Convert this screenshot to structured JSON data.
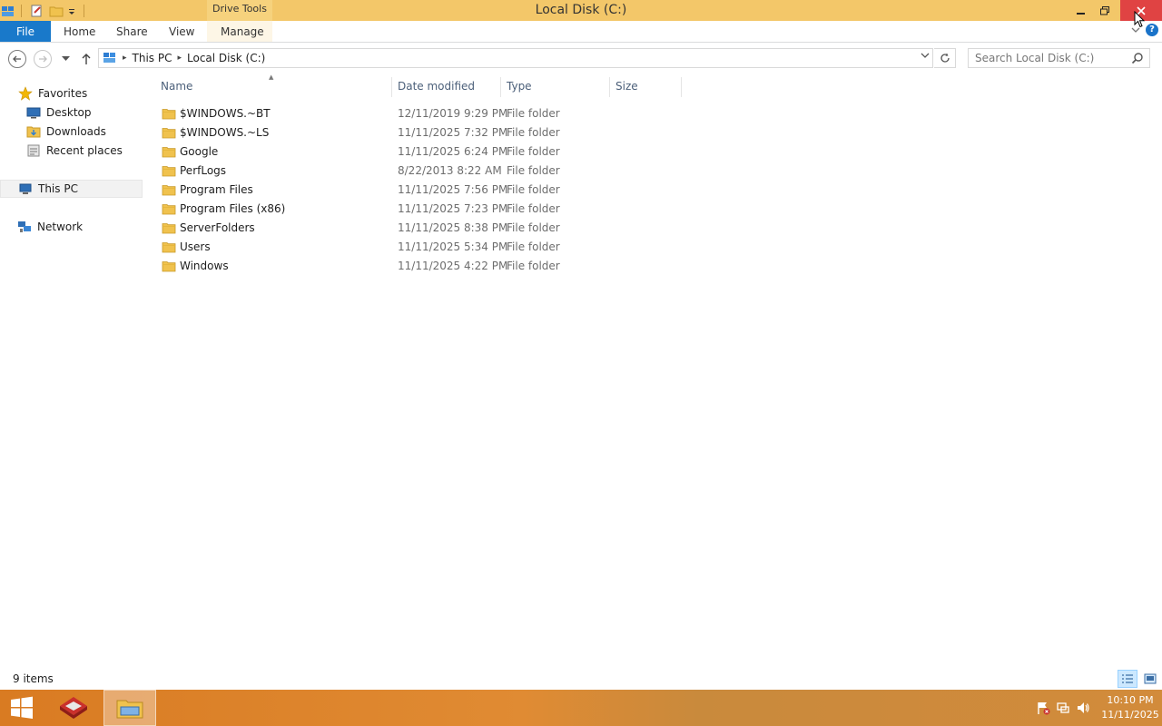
{
  "window": {
    "title": "Local Disk (C:)",
    "contextual_tab_group": "Drive Tools"
  },
  "ribbon": {
    "tabs": [
      {
        "label": "File"
      },
      {
        "label": "Home"
      },
      {
        "label": "Share"
      },
      {
        "label": "View"
      },
      {
        "label": "Manage"
      }
    ]
  },
  "address": {
    "crumbs": [
      "This PC",
      "Local Disk (C:)"
    ]
  },
  "search": {
    "placeholder": "Search Local Disk (C:)"
  },
  "navigation": {
    "favorites": "Favorites",
    "favorites_items": [
      "Desktop",
      "Downloads",
      "Recent places"
    ],
    "this_pc": "This PC",
    "network": "Network"
  },
  "columns": {
    "name": "Name",
    "date_modified": "Date modified",
    "type": "Type",
    "size": "Size"
  },
  "files": [
    {
      "name": "$WINDOWS.~BT",
      "date": "12/11/2019 9:29 PM",
      "type": "File folder"
    },
    {
      "name": "$WINDOWS.~LS",
      "date": "11/11/2025 7:32 PM",
      "type": "File folder"
    },
    {
      "name": "Google",
      "date": "11/11/2025 6:24 PM",
      "type": "File folder"
    },
    {
      "name": "PerfLogs",
      "date": "8/22/2013 8:22 AM",
      "type": "File folder"
    },
    {
      "name": "Program Files",
      "date": "11/11/2025 7:56 PM",
      "type": "File folder"
    },
    {
      "name": "Program Files (x86)",
      "date": "11/11/2025 7:23 PM",
      "type": "File folder"
    },
    {
      "name": "ServerFolders",
      "date": "11/11/2025 8:38 PM",
      "type": "File folder"
    },
    {
      "name": "Users",
      "date": "11/11/2025 5:34 PM",
      "type": "File folder"
    },
    {
      "name": "Windows",
      "date": "11/11/2025 4:22 PM",
      "type": "File folder"
    }
  ],
  "status": {
    "item_count": "9 items"
  },
  "taskbar": {
    "time": "10:10 PM",
    "date": "11/11/2025"
  },
  "colors": {
    "title_bar": "#f3c769",
    "file_tab": "#1979ca",
    "close_button": "#e04343",
    "taskbar": "#d97b22"
  }
}
